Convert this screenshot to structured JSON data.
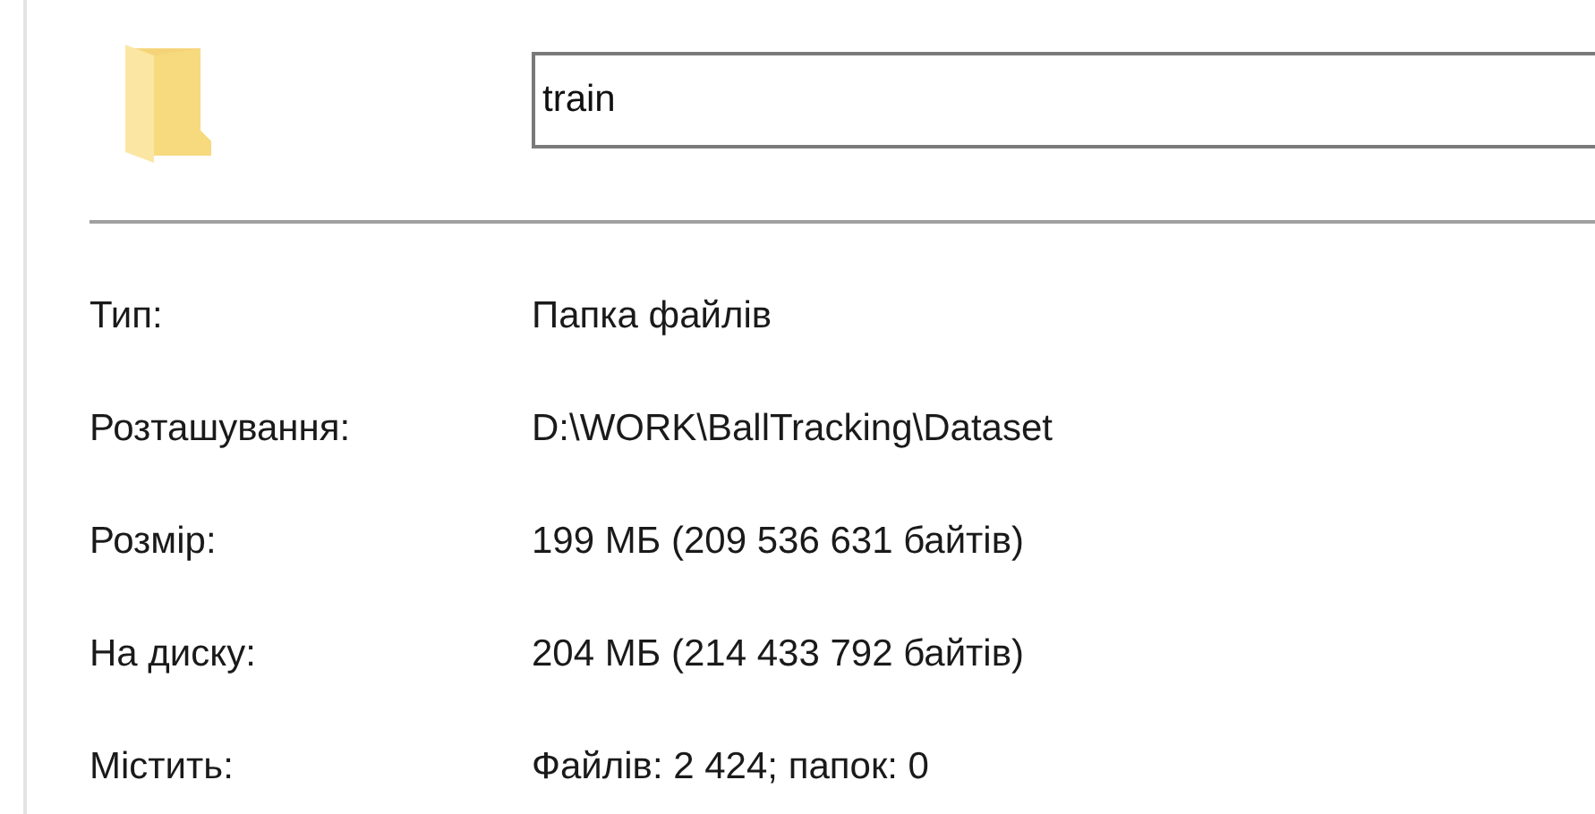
{
  "name_field": {
    "value": "train"
  },
  "properties": [
    {
      "label": "Тип:",
      "value": "Папка файлів"
    },
    {
      "label": "Розташування:",
      "value": "D:\\WORK\\BallTracking\\Dataset"
    },
    {
      "label": "Розмір:",
      "value": "199 МБ (209 536 631 байтів)"
    },
    {
      "label": "На диску:",
      "value": "204 МБ (214 433 792 байтів)"
    },
    {
      "label": "Містить:",
      "value": "Файлів: 2 424; папок: 0"
    }
  ]
}
